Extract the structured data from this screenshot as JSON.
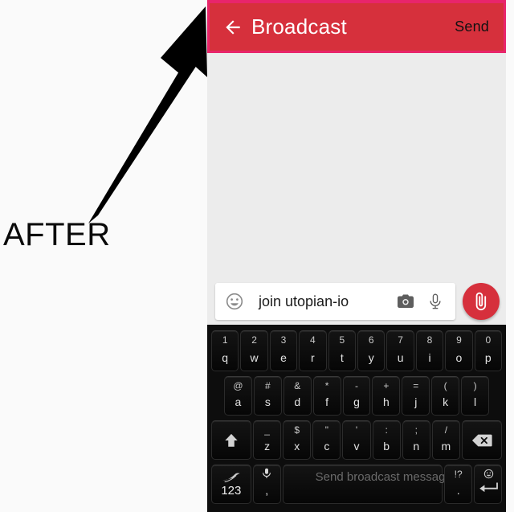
{
  "annotation": {
    "label": "AFTER",
    "arrow_icon": "arrow-up-right-icon",
    "color": "#0a0a0a"
  },
  "phone": {
    "app_bar": {
      "back_icon": "back-arrow-icon",
      "title": "Broadcast",
      "action_label": "Send",
      "background_color": "#d6303c",
      "highlight_border_color": "#e8256b",
      "title_color": "#ffffff"
    },
    "conversation": {
      "background_color": "#ececec",
      "messages": []
    },
    "composer": {
      "emoji_icon": "emoji-smiley-icon",
      "text_value": "join utopian-io",
      "placeholder": "Send broadcast message",
      "camera_icon": "camera-icon",
      "mic_icon": "microphone-icon",
      "attach_icon": "paperclip-icon",
      "attach_button_color": "#d6303c"
    }
  },
  "keyboard": {
    "background_color": "#0d0d0d",
    "spacebar_overlay_text": "Send broadcast message",
    "rows": [
      {
        "id": "row-1",
        "keys": [
          {
            "main": "q",
            "hint": "1"
          },
          {
            "main": "w",
            "hint": "2"
          },
          {
            "main": "e",
            "hint": "3"
          },
          {
            "main": "r",
            "hint": "4"
          },
          {
            "main": "t",
            "hint": "5"
          },
          {
            "main": "y",
            "hint": "6"
          },
          {
            "main": "u",
            "hint": "7"
          },
          {
            "main": "i",
            "hint": "8"
          },
          {
            "main": "o",
            "hint": "9"
          },
          {
            "main": "p",
            "hint": "0"
          }
        ]
      },
      {
        "id": "row-2",
        "keys": [
          {
            "main": "a",
            "hint": "@"
          },
          {
            "main": "s",
            "hint": "#"
          },
          {
            "main": "d",
            "hint": "&"
          },
          {
            "main": "f",
            "hint": "*"
          },
          {
            "main": "g",
            "hint": "-"
          },
          {
            "main": "h",
            "hint": "+"
          },
          {
            "main": "j",
            "hint": "="
          },
          {
            "main": "k",
            "hint": "("
          },
          {
            "main": "l",
            "hint": ")"
          }
        ]
      },
      {
        "id": "row-3",
        "shift_icon": "shift-up-arrow-icon",
        "backspace_icon": "backspace-delete-icon",
        "keys": [
          {
            "main": "z",
            "hint": "_"
          },
          {
            "main": "x",
            "hint": "$"
          },
          {
            "main": "c",
            "hint": "\""
          },
          {
            "main": "v",
            "hint": "'"
          },
          {
            "main": "b",
            "hint": ":"
          },
          {
            "main": "n",
            "hint": ";"
          },
          {
            "main": "m",
            "hint": "/"
          }
        ]
      },
      {
        "id": "row-4",
        "keys": [
          {
            "main": "123",
            "hint": "",
            "icon": "swype-flow-icon",
            "name": "numeric-mode-key"
          },
          {
            "main": ",",
            "hint": "",
            "icon": "microphone-icon",
            "name": "comma-key"
          },
          {
            "main": "",
            "hint": "",
            "icon": "",
            "name": "space-key"
          },
          {
            "main": ".",
            "hint": "!?",
            "icon": "",
            "name": "period-key"
          },
          {
            "main": "",
            "hint": "",
            "icon": "enter-return-icon",
            "name": "enter-key"
          }
        ]
      }
    ]
  }
}
